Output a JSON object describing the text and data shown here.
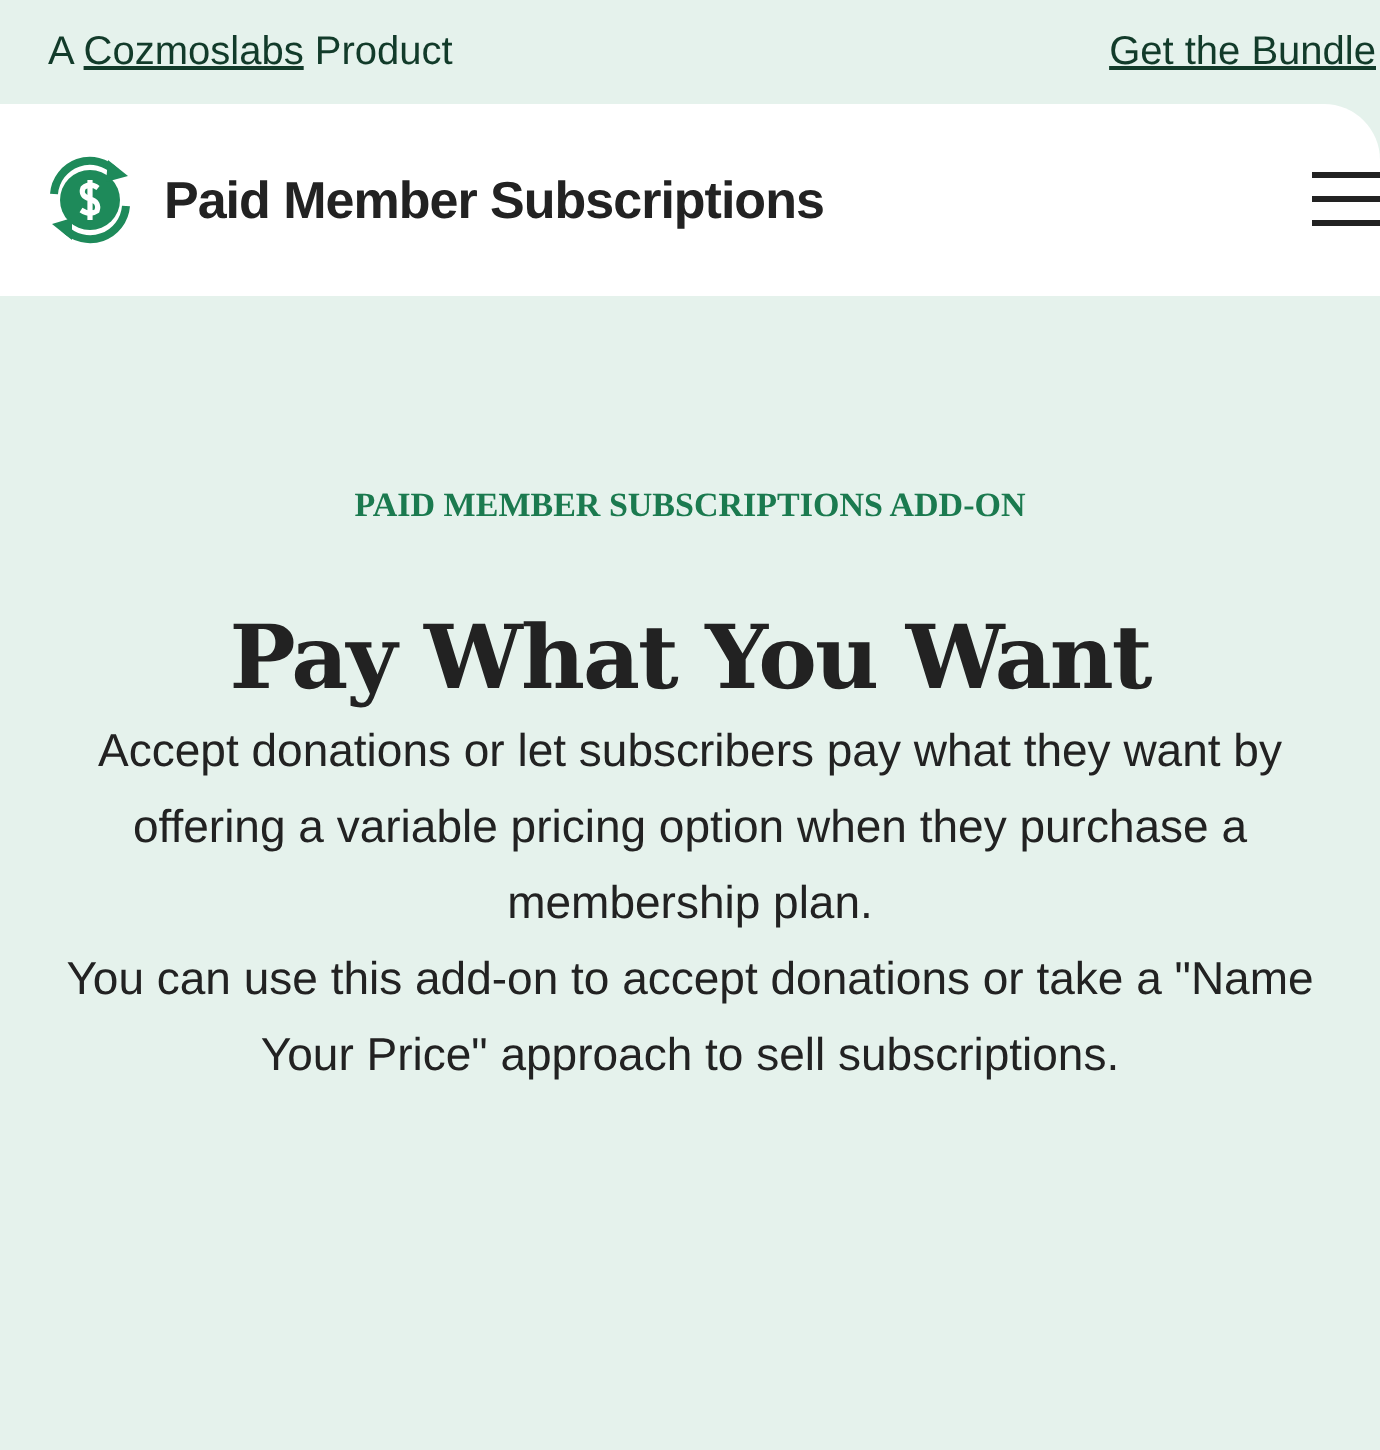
{
  "top_bar": {
    "tagline_link": "Cozmoslabs",
    "tagline_parts": [
      "A ",
      " Product"
    ],
    "bundle_link": "Get the Bundle"
  },
  "header": {
    "brand": "Paid Member Subscriptions"
  },
  "hero": {
    "eyebrow": "PAID MEMBER SUBSCRIPTIONS ADD-ON",
    "title": "Pay What You Want",
    "paragraphs": [
      "Accept donations or let subscribers pay what they want by offering a variable pricing option when they purchase a membership plan.",
      "You can use this add-on to accept donations or take a \"Name Your Price\" approach to sell subscriptions."
    ]
  }
}
